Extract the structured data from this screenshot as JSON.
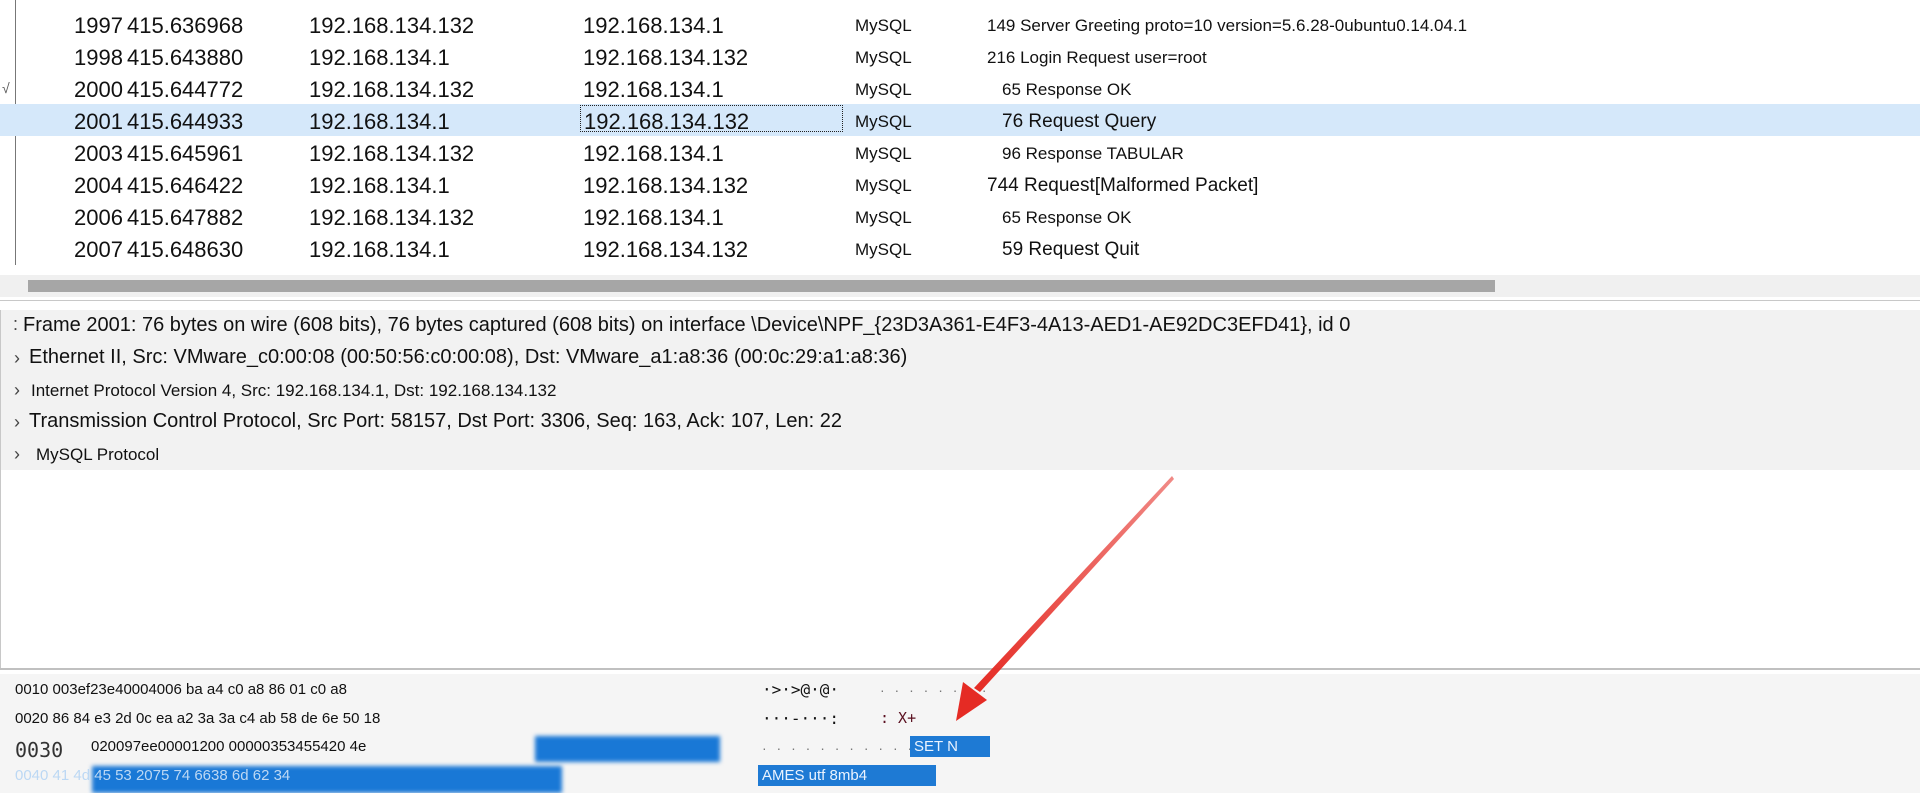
{
  "packets": [
    {
      "no": "1997",
      "time": "415.636968",
      "src": "192.168.134.132",
      "dst": "192.168.134.1",
      "proto": "MySQL",
      "info": "149 Server Greeting proto=10 version=5.6.28-0ubuntu0.14.04.1"
    },
    {
      "no": "1998",
      "time": "415.643880",
      "src": "192.168.134.1",
      "dst": "192.168.134.132",
      "proto": "MySQL",
      "info": "216 Login Request user=root"
    },
    {
      "no": "2000",
      "time": "415.644772",
      "src": "192.168.134.132",
      "dst": "192.168.134.1",
      "proto": "MySQL",
      "info": "65 Response OK"
    },
    {
      "no": "2001",
      "time": "415.644933",
      "src": "192.168.134.1",
      "dst": "192.168.134.132",
      "proto": "MySQL",
      "info": "76 Request Query"
    },
    {
      "no": "2003",
      "time": "415.645961",
      "src": "192.168.134.132",
      "dst": "192.168.134.1",
      "proto": "MySQL",
      "info": "96 Response TABULAR"
    },
    {
      "no": "2004",
      "time": "415.646422",
      "src": "192.168.134.1",
      "dst": "192.168.134.132",
      "proto": "MySQL",
      "info": "744 Request[Malformed Packet]"
    },
    {
      "no": "2006",
      "time": "415.647882",
      "src": "192.168.134.132",
      "dst": "192.168.134.1",
      "proto": "MySQL",
      "info": "65 Response OK"
    },
    {
      "no": "2007",
      "time": "415.648630",
      "src": "192.168.134.1",
      "dst": "192.168.134.132",
      "proto": "MySQL",
      "info": "59 Request Quit"
    }
  ],
  "details": {
    "frame": "Frame 2001: 76 bytes on wire (608 bits), 76 bytes captured (608 bits) on interface \\Device\\NPF_{23D3A361-E4F3-4A13-AED1-AE92DC3EFD41}, id 0",
    "ethernet": "Ethernet II, Src: VMware_c0:00:08 (00:50:56:c0:00:08), Dst: VMware_a1:a8:36 (00:0c:29:a1:a8:36)",
    "ip": "Internet Protocol Version 4, Src: 192.168.134.1, Dst: 192.168.134.132",
    "tcp": "Transmission Control Protocol, Src Port: 58157, Dst Port: 3306, Seq: 163, Ack: 107, Len: 22",
    "mysql": "MySQL Protocol"
  },
  "bytes": {
    "line_0010": "0010 003ef23e40004006 ba a4 c0 a8 86 01 c0 a8",
    "line_0020": "0020 86 84 e3 2d 0c ea a2 3a 3a c4 ab 58 de 6e 50 18",
    "offset_0030": "0030",
    "hex_0030": "020097ee00001200 00000353455420 4e",
    "line_0040": "0040 41 4d 45 53 2075 74 6638 6d 62 34",
    "ascii_0010": "·>·>@·@·",
    "ascii_0020": "···-···:",
    "ascii_0020_tail": ": X+",
    "ascii_0030_sel": "SET N",
    "ascii_0040_sel": "AMES utf 8mb4"
  },
  "colors": {
    "selected_row": "#d5e8fa",
    "byte_highlight": "#1e7ad4",
    "annotation_arrow": "#e52b24"
  }
}
